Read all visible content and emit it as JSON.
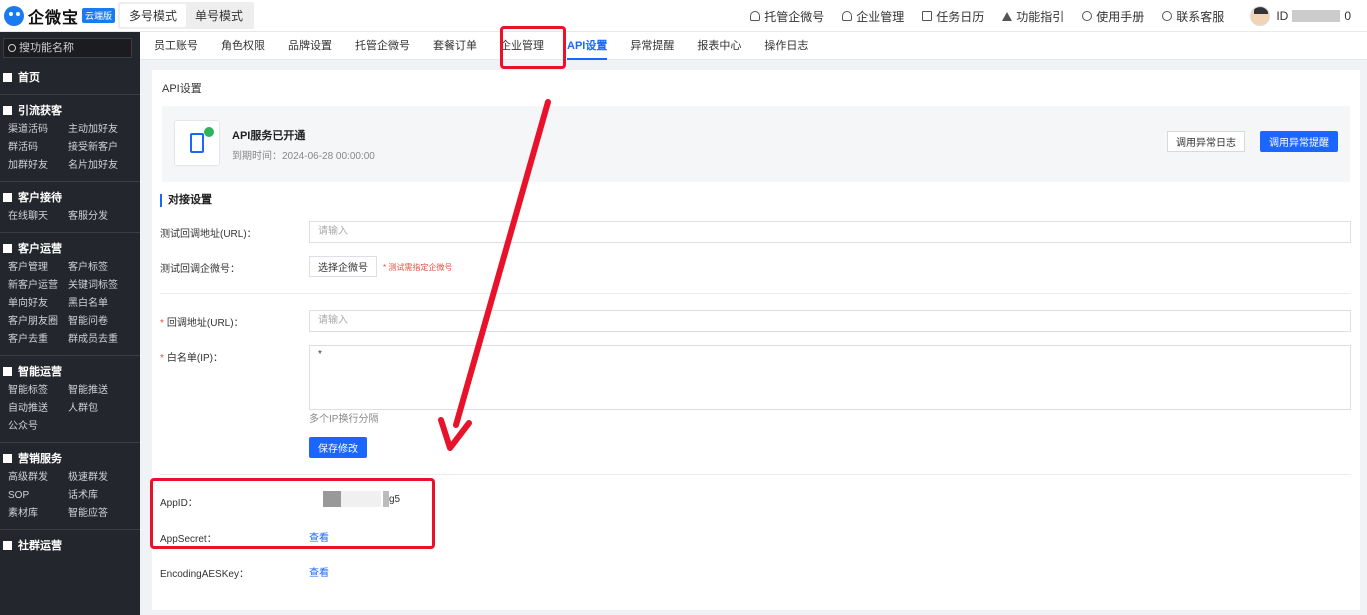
{
  "app": {
    "logo_text": "企微宝",
    "logo_badge": "云端版",
    "modes": [
      "多号模式",
      "单号模式"
    ]
  },
  "top_links": [
    {
      "label": "托管企微号",
      "icon": "person-icon"
    },
    {
      "label": "企业管理",
      "icon": "person-icon"
    },
    {
      "label": "任务日历",
      "icon": "calendar-icon"
    },
    {
      "label": "功能指引",
      "icon": "warning-icon"
    },
    {
      "label": "使用手册",
      "icon": "help-icon"
    },
    {
      "label": "联系客服",
      "icon": "chat-icon"
    }
  ],
  "user": {
    "id_prefix": "ID",
    "id_suffix": "0"
  },
  "sidebar": {
    "search_placeholder": "搜功能名称",
    "home": "首页",
    "sections": [
      {
        "title": "引流获客",
        "items": [
          "渠道活码",
          "主动加好友",
          "群活码",
          "接受新客户",
          "加群好友",
          "名片加好友"
        ]
      },
      {
        "title": "客户接待",
        "items": [
          "在线聊天",
          "客服分发"
        ]
      },
      {
        "title": "客户运营",
        "items": [
          "客户管理",
          "客户标签",
          "新客户运营",
          "关键词标签",
          "单向好友",
          "黑白名单",
          "客户朋友圈",
          "智能问卷",
          "客户去重",
          "群成员去重"
        ]
      },
      {
        "title": "智能运营",
        "items": [
          "智能标签",
          "智能推送",
          "自动推送",
          "人群包",
          "公众号"
        ]
      },
      {
        "title": "营销服务",
        "items": [
          "高级群发",
          "极速群发",
          "SOP",
          "话术库",
          "素材库",
          "智能应答"
        ]
      },
      {
        "title": "社群运营",
        "items": []
      }
    ]
  },
  "tabs": [
    "员工账号",
    "角色权限",
    "品牌设置",
    "托管企微号",
    "套餐订单",
    "企业管理",
    "API设置",
    "异常提醒",
    "报表中心",
    "操作日志"
  ],
  "active_tab": "API设置",
  "main": {
    "page_title": "API设置",
    "api_status_title": "API服务已开通",
    "api_expire": "到期时间：2024-06-28 00:00:00",
    "btn_log": "调用异常日志",
    "btn_alert": "调用异常提醒",
    "section_title": "对接设置",
    "test_url_label": "测试回调地址(URL)：",
    "test_url_placeholder": "请输入",
    "test_wechat_label": "测试回调企微号：",
    "select_btn": "选择企微号",
    "test_hint": "* 测试需指定企微号",
    "callback_label": "回调地址(URL)：",
    "callback_placeholder": "请输入",
    "whitelist_label": "白名单(IP)：",
    "whitelist_value": "*",
    "whitelist_hint": "多个IP换行分隔",
    "save_btn": "保存修改",
    "appid_label": "AppID：",
    "appid_suffix": "g5",
    "appsecret_label": "AppSecret：",
    "view_link": "查看",
    "aeskey_label": "EncodingAESKey：",
    "required_mark": "*"
  },
  "colors": {
    "primary": "#1a66ff",
    "annotation": "#e8132b",
    "sidebar_bg": "#23262c"
  }
}
